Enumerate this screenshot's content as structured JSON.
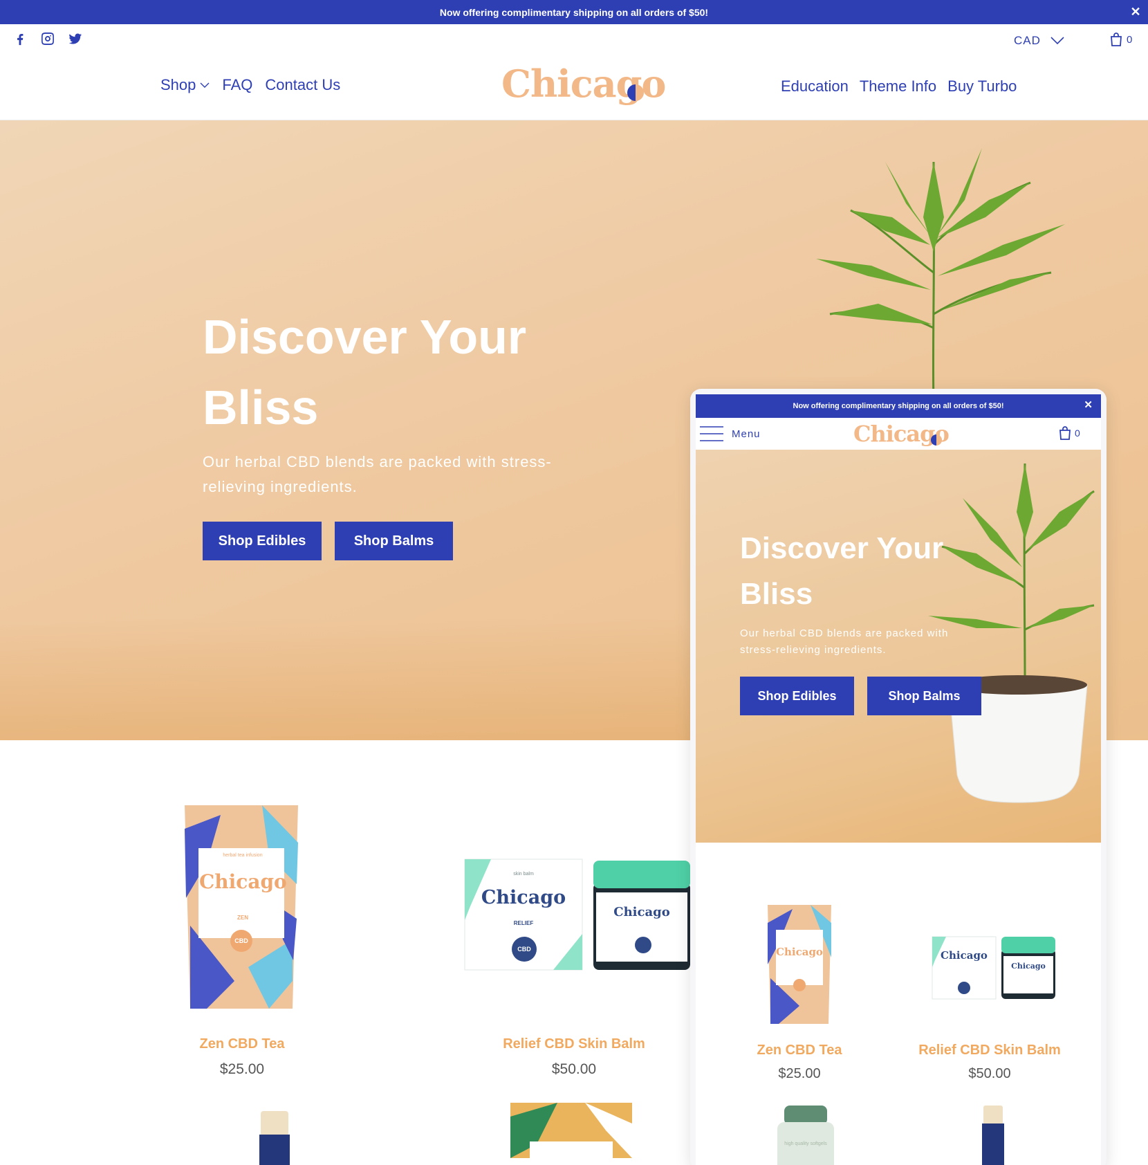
{
  "announcement": {
    "text": "Now offering complimentary shipping on all orders of $50!",
    "close": "✕"
  },
  "header": {
    "social": [
      "facebook-icon",
      "instagram-icon",
      "twitter-icon"
    ],
    "currency": "CAD",
    "cart_count": "0",
    "nav_left": [
      {
        "label": "Shop",
        "dropdown": true
      },
      {
        "label": "FAQ"
      },
      {
        "label": "Contact Us"
      }
    ],
    "nav_right": [
      {
        "label": "Education"
      },
      {
        "label": "Theme Info"
      },
      {
        "label": "Buy Turbo"
      }
    ],
    "logo": "Chicago"
  },
  "hero": {
    "title": "Discover Your Bliss",
    "subtitle": "Our herbal CBD blends are packed with stress-relieving ingredients.",
    "buttons": [
      "Shop Edibles",
      "Shop Balms"
    ]
  },
  "products": [
    {
      "name": "Zen CBD Tea",
      "price": "$25.00"
    },
    {
      "name": "Relief CBD Skin Balm",
      "price": "$50.00"
    }
  ],
  "packaging": {
    "brand": "Chicago",
    "zen": {
      "variant": "ZEN",
      "badge": "CBD",
      "tag": "herbal tea infusion"
    },
    "relief": {
      "variant": "RELIEF",
      "badge": "CBD",
      "tag": "skin balm"
    },
    "supplement_tag": "high quality softgels"
  },
  "mobile": {
    "announcement": "Now offering complimentary shipping on all orders of $50!",
    "menu_label": "Menu",
    "logo": "Chicago",
    "cart_count": "0",
    "hero": {
      "title": "Discover Your Bliss",
      "subtitle": "Our herbal CBD blends are packed with stress-relieving ingredients.",
      "buttons": [
        "Shop Edibles",
        "Shop Balms"
      ]
    },
    "products": [
      {
        "name": "Zen CBD Tea",
        "price": "$25.00"
      },
      {
        "name": "Relief CBD Skin Balm",
        "price": "$50.00"
      }
    ]
  },
  "colors": {
    "brand_blue": "#2e3fb3",
    "peach": "#f3b887",
    "product_orange": "#f0a95f"
  }
}
